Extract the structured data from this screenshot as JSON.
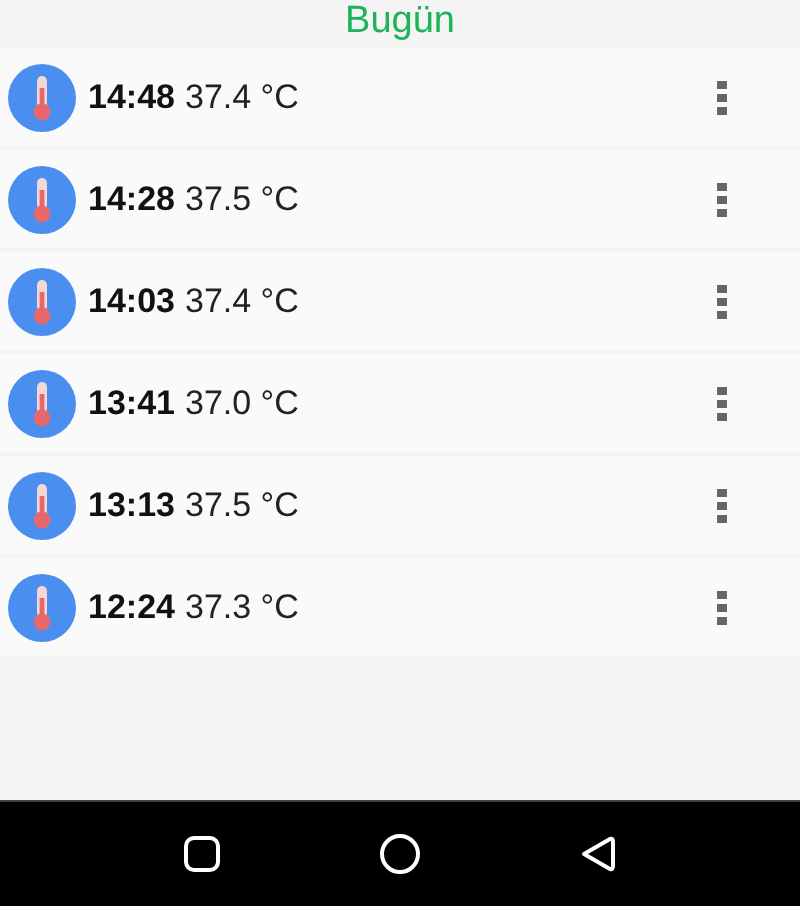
{
  "header": {
    "title": "Bugün"
  },
  "readings": [
    {
      "time": "14:48",
      "temperature": "37.4 °C"
    },
    {
      "time": "14:28",
      "temperature": "37.5 °C"
    },
    {
      "time": "14:03",
      "temperature": "37.4 °C"
    },
    {
      "time": "13:41",
      "temperature": "37.0 °C"
    },
    {
      "time": "13:13",
      "temperature": "37.5 °C"
    },
    {
      "time": "12:24",
      "temperature": "37.3 °C"
    }
  ]
}
